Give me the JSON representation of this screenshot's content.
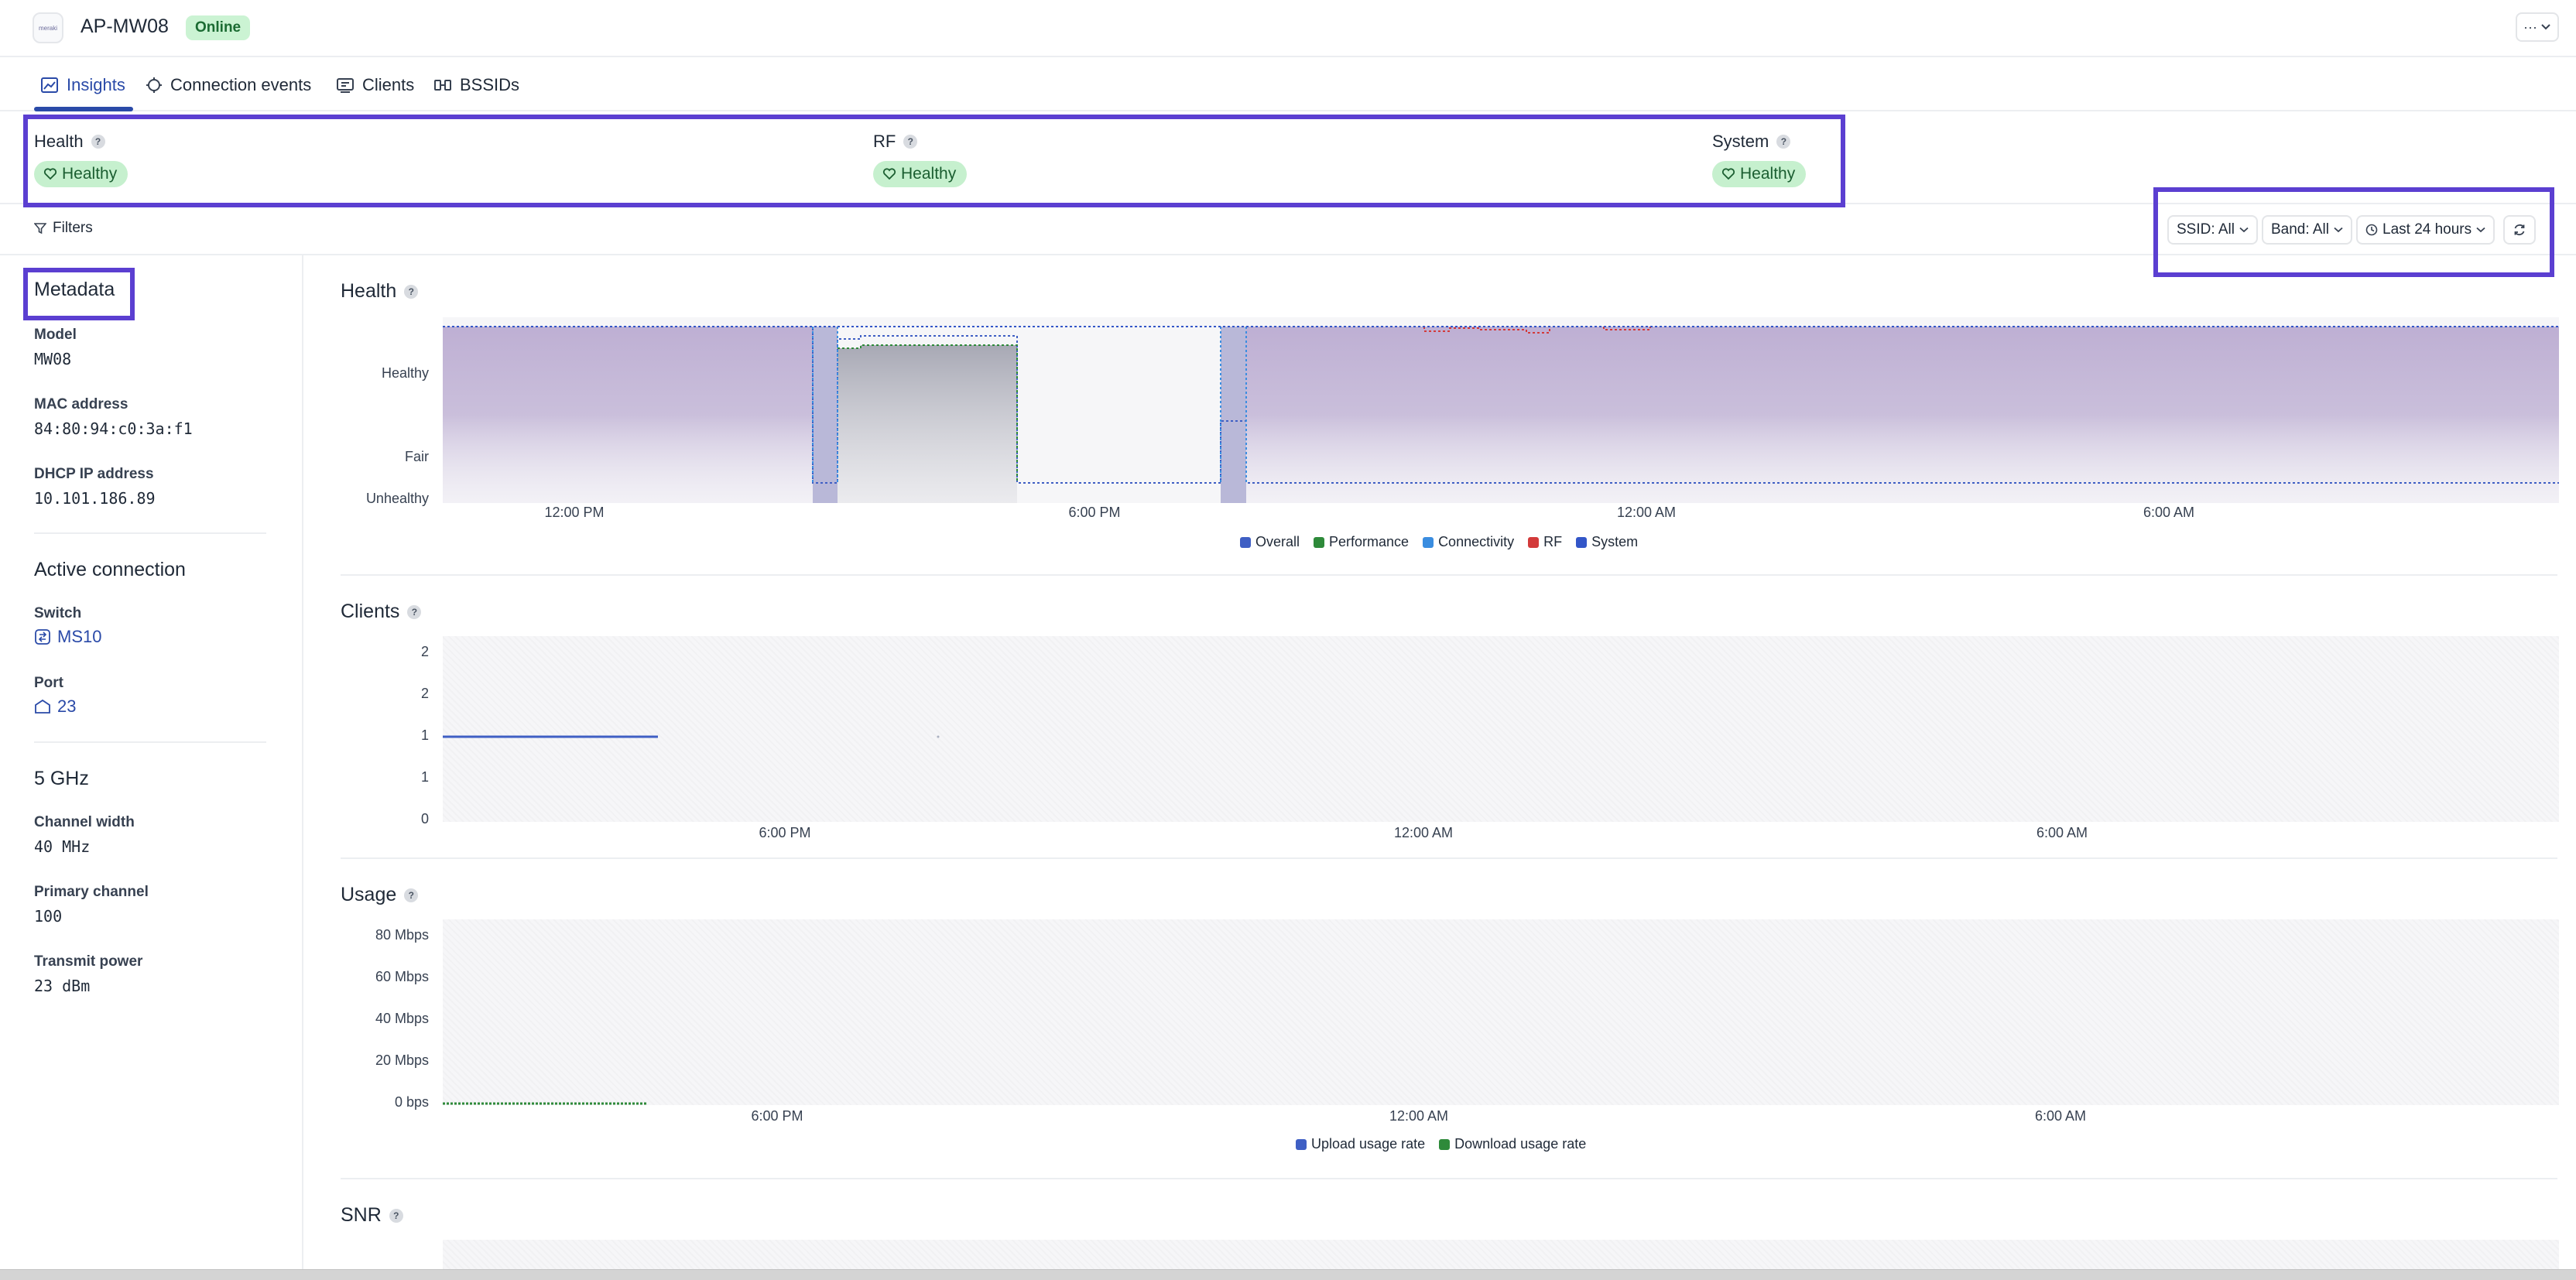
{
  "device": {
    "logo_text": "meraki",
    "name": "AP-MW08",
    "status": "Online",
    "more_label": "···"
  },
  "tabs": [
    {
      "label": "Insights",
      "active": true
    },
    {
      "label": "Connection events"
    },
    {
      "label": "Clients"
    },
    {
      "label": "BSSIDs"
    }
  ],
  "status": [
    {
      "title": "Health",
      "value": "Healthy"
    },
    {
      "title": "RF",
      "value": "Healthy"
    },
    {
      "title": "System",
      "value": "Healthy"
    }
  ],
  "filters": {
    "label": "Filters",
    "ssid": "SSID: All",
    "band": "Band: All",
    "time_range": "Last 24 hours"
  },
  "metadata": {
    "heading": "Metadata",
    "model_label": "Model",
    "model": "MW08",
    "mac_label": "MAC address",
    "mac": "84:80:94:c0:3a:f1",
    "ip_label": "DHCP IP address",
    "ip": "10.101.186.89"
  },
  "active_connection": {
    "heading": "Active connection",
    "switch_label": "Switch",
    "switch": "MS10",
    "port_label": "Port",
    "port": "23"
  },
  "band_5ghz": {
    "heading": "5 GHz",
    "width_label": "Channel width",
    "width": "40 MHz",
    "channel_label": "Primary channel",
    "channel": "100",
    "power_label": "Transmit power",
    "power": "23 dBm"
  },
  "colors": {
    "overall": "#3f5fc4",
    "performance": "#2e8a3a",
    "connectivity": "#3a8de0",
    "rf": "#d33a3a",
    "system": "#3356c8",
    "upload": "#3f5fc4",
    "download": "#2e8a3a",
    "highlight": "#5b3fd1"
  },
  "chart_data": [
    {
      "type": "area",
      "title": "Health",
      "y_ticks": [
        "Unhealthy",
        "Fair",
        "Healthy"
      ],
      "x_ticks": [
        "12:00 PM",
        "6:00 PM",
        "12:00 AM",
        "6:00 AM"
      ],
      "legend": [
        "Overall",
        "Performance",
        "Connectivity",
        "RF",
        "System"
      ],
      "series": [
        {
          "name": "Overall",
          "segments": [
            [
              "10:30 AM",
              "2:45 PM",
              "Healthy"
            ],
            [
              "2:45 PM",
              "3:00 PM",
              "Unhealthy"
            ],
            [
              "3:00 PM",
              "4:45 PM",
              "Fair"
            ],
            [
              "4:45 PM",
              "7:30 PM",
              "Unhealthy"
            ],
            [
              "7:30 PM",
              "7:45 PM",
              "Fair"
            ],
            [
              "7:45 PM",
              "10:30 AM",
              "Unhealthy"
            ]
          ]
        },
        {
          "name": "Performance",
          "segments": [
            [
              "3:00 PM",
              "5:00 PM",
              "Healthy"
            ],
            [
              "5:00 PM",
              "7:30 PM",
              "Unhealthy"
            ]
          ]
        },
        {
          "name": "Connectivity",
          "segments": [
            [
              "2:45 PM",
              "3:00 PM",
              "Healthy"
            ],
            [
              "7:30 PM",
              "7:45 PM",
              "Healthy"
            ]
          ]
        },
        {
          "name": "RF",
          "segments": [
            [
              "9:30 PM",
              "12:00 AM",
              "Healthy"
            ]
          ]
        },
        {
          "name": "System",
          "segments": [
            [
              "10:30 AM",
              "10:30 AM",
              "Healthy"
            ]
          ]
        }
      ]
    },
    {
      "type": "line",
      "title": "Clients",
      "y_ticks": [
        "0",
        "1",
        "1",
        "2",
        "2"
      ],
      "ylim": [
        0,
        2
      ],
      "x_ticks": [
        "6:00 PM",
        "12:00 AM",
        "6:00 AM"
      ],
      "series": [
        {
          "name": "",
          "points": [
            [
              "1:00 PM",
              1
            ],
            [
              "3:00 PM",
              1
            ]
          ]
        }
      ]
    },
    {
      "type": "line",
      "title": "Usage",
      "y_ticks": [
        "0 bps",
        "20 Mbps",
        "40 Mbps",
        "60 Mbps",
        "80 Mbps"
      ],
      "ylim": [
        0,
        80
      ],
      "x_ticks": [
        "6:00 PM",
        "12:00 AM",
        "6:00 AM"
      ],
      "legend": [
        "Upload usage rate",
        "Download usage rate"
      ],
      "series": [
        {
          "name": "Download usage rate",
          "points": [
            [
              "1:00 PM",
              0
            ],
            [
              "3:00 PM",
              0
            ]
          ]
        }
      ]
    },
    {
      "type": "line",
      "title": "SNR"
    }
  ]
}
